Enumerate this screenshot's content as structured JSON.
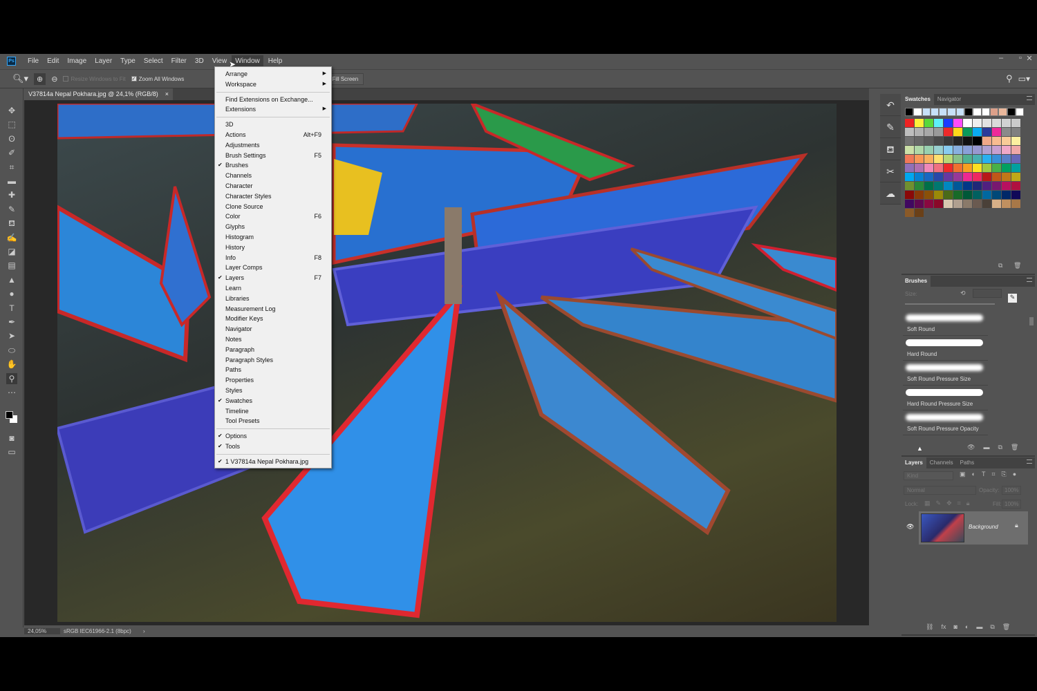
{
  "app": {
    "logo": "Ps"
  },
  "menubar": [
    "File",
    "Edit",
    "Image",
    "Layer",
    "Type",
    "Select",
    "Filter",
    "3D",
    "View",
    "Window",
    "Help"
  ],
  "options": {
    "resize_windows": "Resize Windows to Fit",
    "zoom_all": "Zoom All Windows",
    "fill_screen": "Fill Screen"
  },
  "document_tab": {
    "title": "V37814a Nepal Pokhara.jpg @ 24,1% (RGB/8)",
    "close": "×"
  },
  "status": {
    "zoom": "24,05%",
    "profile": "sRGB IEC61966-2.1 (8bpc)",
    "arrow": "›"
  },
  "window_menu": [
    [
      {
        "label": "Arrange",
        "sub": true
      },
      {
        "label": "Workspace",
        "sub": true
      }
    ],
    [
      {
        "label": "Find Extensions on Exchange..."
      },
      {
        "label": "Extensions",
        "sub": true
      }
    ],
    [
      {
        "label": "3D"
      },
      {
        "label": "Actions",
        "shortcut": "Alt+F9"
      },
      {
        "label": "Adjustments"
      },
      {
        "label": "Brush Settings",
        "shortcut": "F5"
      },
      {
        "label": "Brushes",
        "checked": true
      },
      {
        "label": "Channels"
      },
      {
        "label": "Character"
      },
      {
        "label": "Character Styles"
      },
      {
        "label": "Clone Source"
      },
      {
        "label": "Color",
        "shortcut": "F6"
      },
      {
        "label": "Glyphs"
      },
      {
        "label": "Histogram"
      },
      {
        "label": "History"
      },
      {
        "label": "Info",
        "shortcut": "F8"
      },
      {
        "label": "Layer Comps"
      },
      {
        "label": "Layers",
        "shortcut": "F7",
        "checked": true
      },
      {
        "label": "Learn"
      },
      {
        "label": "Libraries"
      },
      {
        "label": "Measurement Log"
      },
      {
        "label": "Modifier Keys"
      },
      {
        "label": "Navigator"
      },
      {
        "label": "Notes"
      },
      {
        "label": "Paragraph"
      },
      {
        "label": "Paragraph Styles"
      },
      {
        "label": "Paths"
      },
      {
        "label": "Properties"
      },
      {
        "label": "Styles"
      },
      {
        "label": "Swatches",
        "checked": true
      },
      {
        "label": "Timeline"
      },
      {
        "label": "Tool Presets"
      }
    ],
    [
      {
        "label": "Options",
        "checked": true
      },
      {
        "label": "Tools",
        "checked": true
      }
    ],
    [
      {
        "label": "1 V37814a Nepal Pokhara.jpg",
        "checked": true
      }
    ]
  ],
  "swatches_panel": {
    "tabs": [
      "Swatches",
      "Navigator"
    ],
    "recent": [
      "#000000",
      "#ffffff",
      "#c6e0f8",
      "#c6e0f8",
      "#c6e0f8",
      "#c6e0f8",
      "#c6e0f8",
      "#000000",
      "#ffffff",
      "#ffffff",
      "#dca08a",
      "#eab89c",
      "#000000",
      "#ffffff"
    ],
    "colors": [
      "#ee2222",
      "#fff03a",
      "#5ad83a",
      "#5ef0f8",
      "#1a3cff",
      "#ff4cf8",
      "#ffffff",
      "#eeeeee",
      "#e2e2e2",
      "#dadada",
      "#d2d2d2",
      "#cacaca",
      "#bebebe",
      "#b2b2b2",
      "#a8a8a8",
      "#9a9a9a",
      "#ee2a2a",
      "#ffd81a",
      "#0a9a5a",
      "#0aaaf0",
      "#2a3a9a",
      "#ee2a9a",
      "#8a8a8a",
      "#808080",
      "#727272",
      "#666666",
      "#5a5a5a",
      "#4a4a4a",
      "#3a3a3a",
      "#262626",
      "#121212",
      "#000000",
      "#f0a888",
      "#f8bc90",
      "#f8cc98",
      "#fcf0a0",
      "#cce0a8",
      "#b0d8a8",
      "#98d0b0",
      "#98d0d0",
      "#88ccf0",
      "#88b0e0",
      "#8aa0d8",
      "#9898d0",
      "#b0a0d0",
      "#c8a0d0",
      "#f0a8c8",
      "#f0a8a8",
      "#f07858",
      "#f89858",
      "#f8b060",
      "#fce070",
      "#b8d878",
      "#88c088",
      "#50b090",
      "#48b0b0",
      "#28b0f0",
      "#3890d8",
      "#5880c8",
      "#6868b8",
      "#9070b8",
      "#b070b0",
      "#f088b8",
      "#f07080",
      "#ee2a2a",
      "#f07030",
      "#f8a020",
      "#fce020",
      "#a0c840",
      "#48b048",
      "#00a060",
      "#00a0a0",
      "#00a8f0",
      "#0880d0",
      "#1868c0",
      "#2848a8",
      "#6838a0",
      "#983898",
      "#ee2890",
      "#ee2860",
      "#b81818",
      "#c05818",
      "#c07818",
      "#c0a818",
      "#709030",
      "#2a8838",
      "#007048",
      "#007870",
      "#0088c0",
      "#005898",
      "#003888",
      "#202878",
      "#502080",
      "#781870",
      "#b81060",
      "#b01040",
      "#8a0808",
      "#8a3808",
      "#8a5008",
      "#9a8a08",
      "#4a6a18",
      "#186a28",
      "#005838",
      "#006060",
      "#0068a0",
      "#004878",
      "#002868",
      "#100858",
      "#400860",
      "#600850",
      "#8a0840",
      "#8a0828",
      "#d8c8b0",
      "#b0a090",
      "#8a7a6a",
      "#6a5a50",
      "#4a4038",
      "#d8b088",
      "#c09060",
      "#a87848",
      "#8a5a28",
      "#6a4018"
    ]
  },
  "brushes_panel": {
    "title": "Brushes",
    "size_label": "Size:",
    "presets": [
      {
        "name": "Soft Round",
        "soft": true
      },
      {
        "name": "Hard Round",
        "soft": false
      },
      {
        "name": "Soft Round Pressure Size",
        "soft": true
      },
      {
        "name": "Hard Round Pressure Size",
        "soft": false
      },
      {
        "name": "Soft Round Pressure Opacity",
        "soft": true
      }
    ]
  },
  "layers_panel": {
    "tabs": [
      "Layers",
      "Channels",
      "Paths"
    ],
    "kind": "Kind",
    "blend": "Normal",
    "opacity_label": "Opacity:",
    "opacity": "100%",
    "lock_label": "Lock:",
    "fill_label": "Fill:",
    "fill": "100%",
    "layers": [
      {
        "name": "Background",
        "visible": true,
        "locked": true
      }
    ]
  }
}
